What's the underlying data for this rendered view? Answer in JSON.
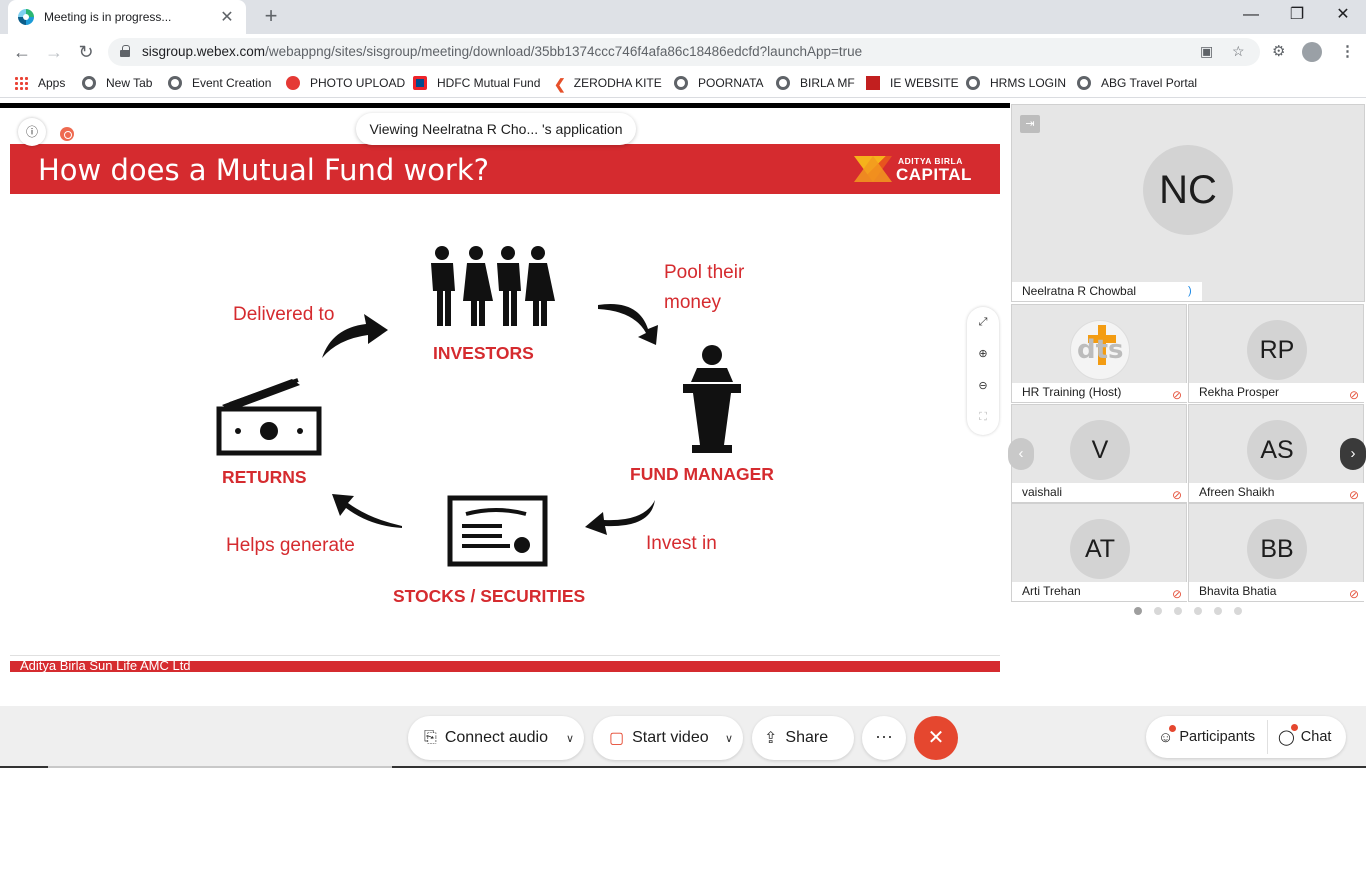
{
  "browser": {
    "tab_title": "Meeting is in progress...",
    "tab_close": "✕",
    "new_tab": "+",
    "url_host": "sisgroup.webex.com",
    "url_path": "/webappng/sites/sisgroup/meeting/download/35bb1374ccc746f4afa86c18486edcfd?launchApp=true",
    "bookmarks": [
      {
        "label": "Apps",
        "icon": "apps-grid-icon"
      },
      {
        "label": "New Tab",
        "icon": "globe-icon"
      },
      {
        "label": "Event Creation",
        "icon": "globe-icon"
      },
      {
        "label": "PHOTO UPLOAD",
        "icon": "red-circle-icon"
      },
      {
        "label": "HDFC Mutual Fund",
        "icon": "hdfc-icon"
      },
      {
        "label": "ZERODHA KITE",
        "icon": "kite-icon"
      },
      {
        "label": "POORNATA",
        "icon": "globe-icon"
      },
      {
        "label": "BIRLA MF",
        "icon": "globe-icon"
      },
      {
        "label": "IE WEBSITE",
        "icon": "ie-icon"
      },
      {
        "label": "HRMS LOGIN",
        "icon": "globe-icon"
      },
      {
        "label": "ABG Travel Portal",
        "icon": "globe-icon"
      }
    ]
  },
  "meeting": {
    "viewing_text": "Viewing Neelratna R Cho... 's application",
    "info_glyph": "ⓘ"
  },
  "slide": {
    "title": "How does a Mutual Fund work?",
    "brand_top": "ADITYA BIRLA",
    "brand_bottom": "CAPITAL",
    "labels": {
      "investors": "INVESTORS",
      "pool_line1": "Pool their",
      "pool_line2": "money",
      "fund_manager": "FUND MANAGER",
      "invest_in": "Invest in",
      "stocks": "STOCKS / SECURITIES",
      "helps_generate": "Helps generate",
      "returns": "RETURNS",
      "delivered_to": "Delivered to"
    },
    "footer": "Aditya Birla Sun Life AMC Ltd"
  },
  "participants_panel": {
    "active_speaker": {
      "initials": "NC",
      "name": "Neelratna R Chowbal"
    },
    "tiles": [
      {
        "initials": "",
        "name": "HR Training (Host)",
        "logo_text": "dts"
      },
      {
        "initials": "RP",
        "name": "Rekha Prosper"
      },
      {
        "initials": "V",
        "name": "vaishali"
      },
      {
        "initials": "AS",
        "name": "Afreen Shaikh"
      },
      {
        "initials": "AT",
        "name": "Arti Trehan"
      },
      {
        "initials": "BB",
        "name": "Bhavita Bhatia"
      }
    ],
    "page_count": 6,
    "current_page": 1
  },
  "controls": {
    "connect_audio": "Connect audio",
    "start_video": "Start video",
    "share": "Share",
    "more": "···",
    "end": "✕",
    "participants": "Participants",
    "chat": "Chat"
  },
  "colors": {
    "slide_red": "#d52b2f",
    "end_red": "#e5472f"
  }
}
